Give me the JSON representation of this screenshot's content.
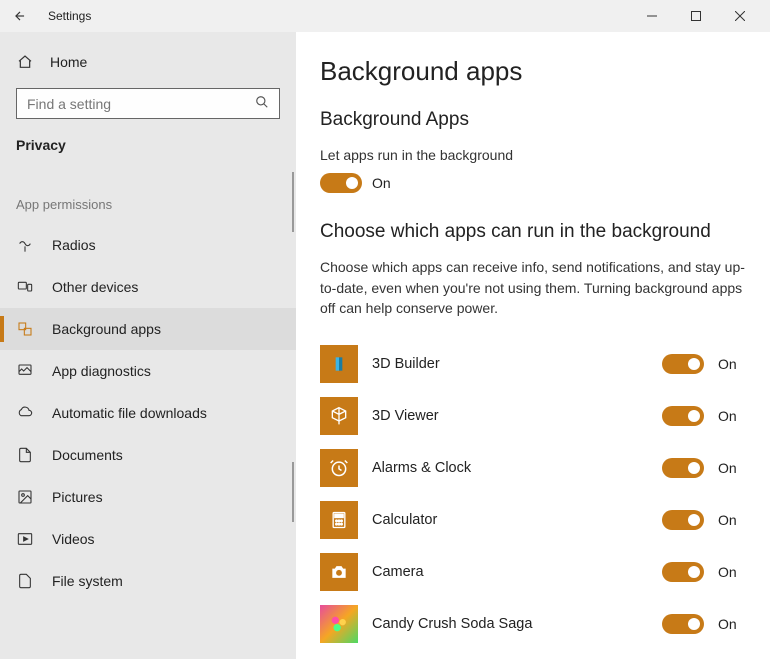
{
  "window": {
    "title": "Settings"
  },
  "sidebar": {
    "home_label": "Home",
    "search_placeholder": "Find a setting",
    "section_label": "Privacy",
    "group_label": "App permissions",
    "items": [
      {
        "label": "Radios"
      },
      {
        "label": "Other devices"
      },
      {
        "label": "Background apps"
      },
      {
        "label": "App diagnostics"
      },
      {
        "label": "Automatic file downloads"
      },
      {
        "label": "Documents"
      },
      {
        "label": "Pictures"
      },
      {
        "label": "Videos"
      },
      {
        "label": "File system"
      }
    ],
    "selected_index": 2
  },
  "main": {
    "heading": "Background apps",
    "subheading1": "Background Apps",
    "master_desc": "Let apps run in the background",
    "master_state": "On",
    "subheading2": "Choose which apps can run in the background",
    "desc2": "Choose which apps can receive info, send notifications, and stay up-to-date, even when you're not using them. Turning background apps off can help conserve power.",
    "apps": [
      {
        "name": "3D Builder",
        "state": "On"
      },
      {
        "name": "3D Viewer",
        "state": "On"
      },
      {
        "name": "Alarms & Clock",
        "state": "On"
      },
      {
        "name": "Calculator",
        "state": "On"
      },
      {
        "name": "Camera",
        "state": "On"
      },
      {
        "name": "Candy Crush Soda Saga",
        "state": "On"
      }
    ]
  }
}
